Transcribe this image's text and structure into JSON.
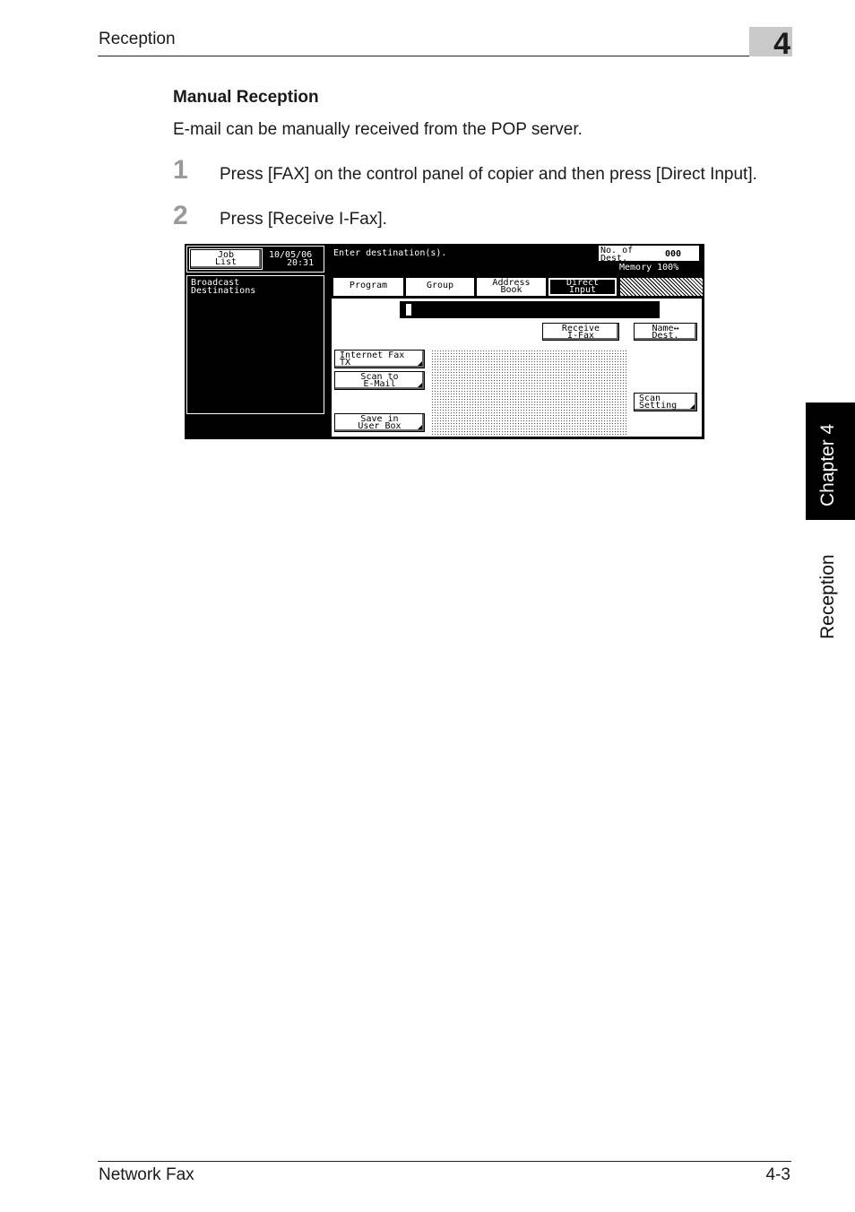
{
  "header": {
    "title": "Reception",
    "chapter_number": "4"
  },
  "section": {
    "title": "Manual Reception",
    "intro": "E-mail can be manually received from the POP server."
  },
  "steps": [
    {
      "num": "1",
      "text": "Press [FAX] on the control panel of copier and then press [Direct Input]."
    },
    {
      "num": "2",
      "text": "Press [Receive I-Fax]."
    }
  ],
  "side_tab": {
    "chapter": "Chapter 4",
    "section": "Reception"
  },
  "footer": {
    "left": "Network Fax",
    "right": "4-3"
  },
  "panel": {
    "job_list": [
      "Job",
      "List"
    ],
    "date": "10/05/06",
    "time": "20:31",
    "broadcast_label": [
      "Broadcast",
      "Destinations"
    ],
    "message": "Enter destination(s).",
    "num_dest_label": [
      "No. of",
      "Dest."
    ],
    "num_dest_value": "000",
    "memory": "Memory 100%",
    "tabs": {
      "program": [
        "Program"
      ],
      "group": [
        "Group"
      ],
      "address_book": [
        "Address",
        "Book"
      ],
      "direct_input": [
        "Direct",
        "Input"
      ]
    },
    "buttons": {
      "receive_ifax": [
        "Receive",
        "I-Fax"
      ],
      "name_dest": [
        "Name↔",
        "Dest."
      ],
      "internet_fax_tx": [
        "Internet Fax",
        "TX"
      ],
      "scan_to_email": [
        "Scan to",
        "E-Mail"
      ],
      "save_in_user_box": [
        "Save in",
        "User Box"
      ],
      "scan_setting": [
        "Scan",
        "Setting"
      ]
    }
  }
}
